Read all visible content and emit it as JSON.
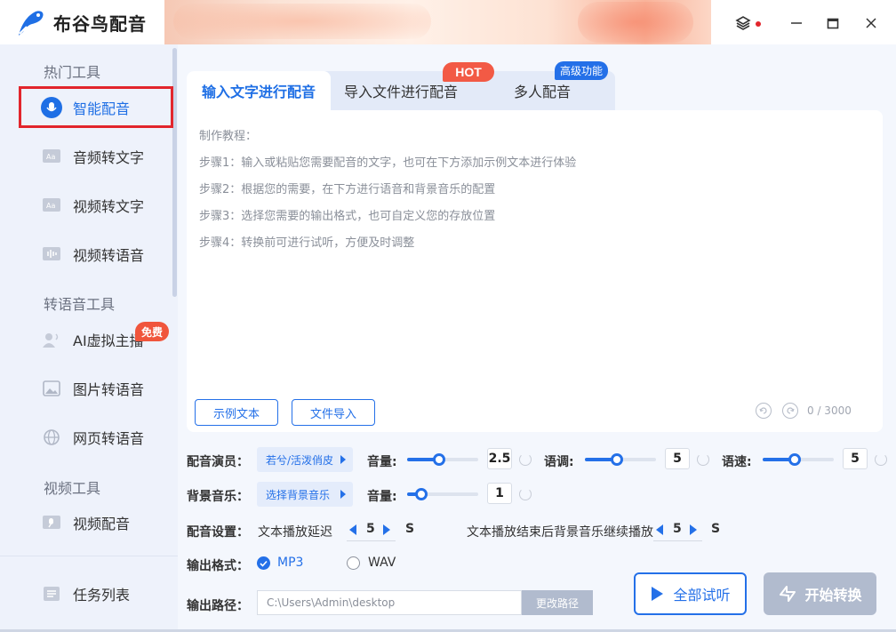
{
  "app": {
    "title": "布谷鸟配音"
  },
  "window": {
    "layers_icon": "layers-icon",
    "notify_dot_color": "#e2252c"
  },
  "sidebar": {
    "sections": [
      {
        "title": "热门工具"
      },
      {
        "title": "转语音工具"
      },
      {
        "title": "视频工具"
      }
    ],
    "items": [
      {
        "label": "智能配音",
        "icon": "mic-icon",
        "active": true
      },
      {
        "label": "音频转文字",
        "icon": "audio-text-icon"
      },
      {
        "label": "视频转文字",
        "icon": "video-text-icon"
      },
      {
        "label": "视频转语音",
        "icon": "video-voice-icon"
      },
      {
        "label": "AI虚拟主播",
        "icon": "anchor-icon",
        "badge": "免费"
      },
      {
        "label": "图片转语音",
        "icon": "image-icon"
      },
      {
        "label": "网页转语音",
        "icon": "globe-icon"
      },
      {
        "label": "视频配音",
        "icon": "video-dub-icon"
      },
      {
        "label": "任务列表",
        "icon": "task-list-icon"
      }
    ]
  },
  "tabs": [
    {
      "label": "输入文字进行配音",
      "active": true
    },
    {
      "label": "导入文件进行配音",
      "badge": "HOT"
    },
    {
      "label": "多人配音",
      "badge": "高级功能"
    }
  ],
  "editor": {
    "guide_title": "制作教程：",
    "steps": [
      "步骤1：输入或粘贴您需要配音的文字，也可在下方添加示例文本进行体验",
      "步骤2：根据您的需要，在下方进行语音和背景音乐的配置",
      "步骤3：选择您需要的输出格式，也可自定义您的存放位置",
      "步骤4：转换前可进行试听，方便及时调整"
    ],
    "sample_button": "示例文本",
    "import_button": "文件导入",
    "char_count": "0 / 3000"
  },
  "settings": {
    "voice_label": "配音演员：",
    "voice_value": "若兮/活泼俏皮",
    "volume_label": "音量:",
    "volume_value": "2.5",
    "volume_level": 0.45,
    "pitch_label": "语调:",
    "pitch_value": "5",
    "pitch_level": 0.45,
    "speed_label": "语速:",
    "speed_value": "5",
    "speed_level": 0.45,
    "bgm_label": "背景音乐：",
    "bgm_value": "选择背景音乐",
    "bgm_volume_label": "音量:",
    "bgm_volume_value": "1",
    "bgm_volume_level": 0.2,
    "dub_label": "配音设置：",
    "delay_label": "文本播放延迟",
    "delay_value": "5",
    "delay_unit": "S",
    "continue_label": "文本播放结束后背景音乐继续播放",
    "continue_value": "5",
    "continue_unit": "S",
    "format_label": "输出格式：",
    "formats": [
      {
        "label": "MP3",
        "checked": true
      },
      {
        "label": "WAV",
        "checked": false
      }
    ],
    "path_label": "输出路径：",
    "path_value": "C:\\Users\\Admin\\desktop",
    "path_button": "更改路径"
  },
  "actions": {
    "preview": "全部试听",
    "convert": "开始转换"
  },
  "colors": {
    "accent": "#2470e8",
    "hot": "#f25a45",
    "sidebar_bg": "#eef2fb",
    "disabled_btn": "#b1bbce"
  }
}
